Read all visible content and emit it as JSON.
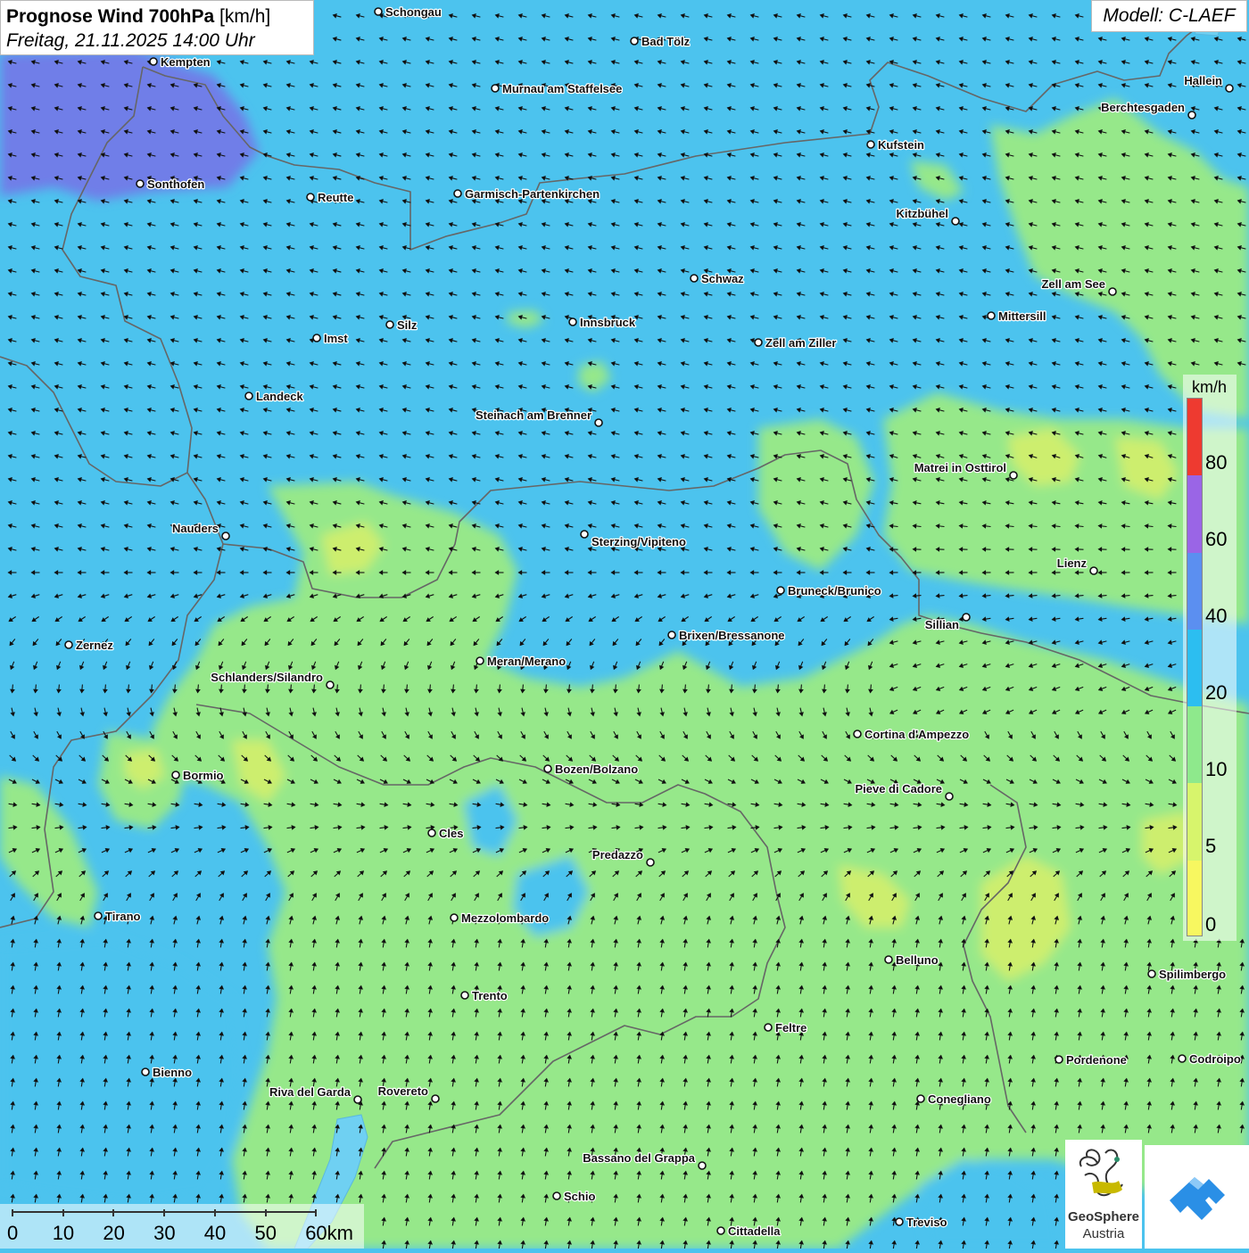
{
  "title": {
    "main_bold": "Prognose Wind 700hPa",
    "main_unit": "[km/h]",
    "date": "Freitag, 21.11.2025 14:00 Uhr"
  },
  "model_label": "Modell: C-LAEF",
  "legend": {
    "unit": "km/h",
    "ticks": [
      "80",
      "60",
      "40",
      "20",
      "10",
      "5",
      "0"
    ],
    "colors": [
      "#ee3a30",
      "#9a65e6",
      "#5b8ff0",
      "#2cbef0",
      "#8ee98c",
      "#d7f56c",
      "#f7f760"
    ]
  },
  "scale_bar": {
    "labels": [
      "0",
      "10",
      "20",
      "30",
      "40",
      "50",
      "60km"
    ]
  },
  "logos": {
    "geosphere_line1": "GeoSphere",
    "geosphere_line2": "Austria",
    "geosphere_icon": "geosphere-swirl-icon",
    "app_icon": "uwz-mountain-icon"
  },
  "colors": {
    "wind_blue": "#4cc3ee",
    "wind_deep_blue": "#6f7ee8",
    "wind_green": "#96e88a",
    "wind_yellow": "#cdee6e",
    "lake": "#6fd0f2",
    "border": "#666666",
    "arrow": "#111111"
  },
  "cities": [
    "Schongau",
    "Bad Tölz",
    "Kempten",
    "Murnau am Staffelsee",
    "Hallein",
    "Berchtesgaden",
    "Kufstein",
    "Sonthofen",
    "Reutte",
    "Garmisch-Partenkirchen",
    "Kitzbühel",
    "Schwaz",
    "Zell am See",
    "Mittersill",
    "Innsbruck",
    "Silz",
    "Imst",
    "Zell am Ziller",
    "Landeck",
    "Steinach am Brenner",
    "Matrei in Osttirol",
    "Nauders",
    "Sterzing/Vipiteno",
    "Lienz",
    "Bruneck/Brunico",
    "Sillian",
    "Brixen/Bressanone",
    "Zernez",
    "Meran/Merano",
    "Schlanders/Silandro",
    "Cortina d'Ampezzo",
    "Bozen/Bolzano",
    "Bormio",
    "Pieve di Cadore",
    "Cles",
    "Predazzo",
    "Tirano",
    "Mezzolombardo",
    "Belluno",
    "Spilimbergo",
    "Trento",
    "Feltre",
    "Pordenone",
    "Codroipo",
    "Bienno",
    "Riva del Garda",
    "Rovereto",
    "Conegliano",
    "Bassano del Grappa",
    "Schio",
    "Treviso",
    "Cittadella"
  ]
}
